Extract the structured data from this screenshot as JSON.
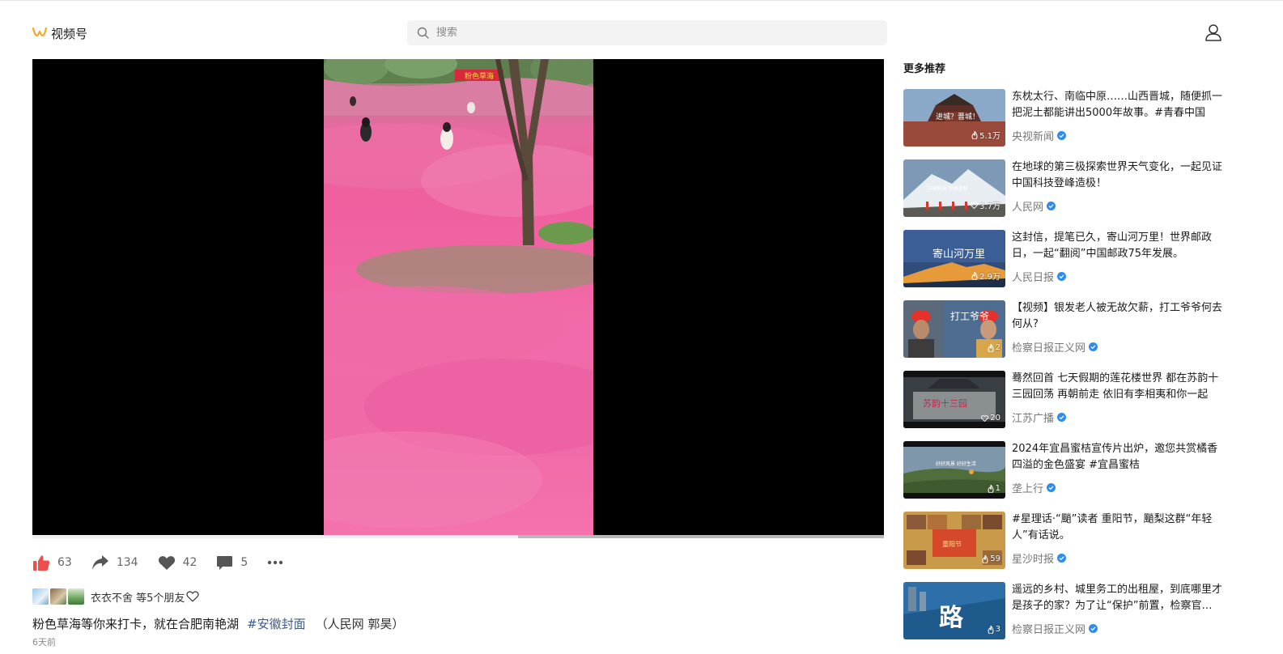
{
  "header": {
    "app_name": "视频号",
    "search_placeholder": "搜索"
  },
  "video": {
    "progress": 0.43,
    "banner_text": "粉色草海"
  },
  "actions": {
    "like_count": "63",
    "share_count": "134",
    "favorite_count": "42",
    "comment_count": "5"
  },
  "friends": {
    "text": "衣衣不舍 等5个朋友"
  },
  "post": {
    "caption": "粉色草海等你来打卡，就在合肥南艳湖",
    "hashtag": "#安徽封面",
    "source": "（人民网 郭昊）",
    "time": "6天前"
  },
  "sidebar": {
    "title": "更多推荐",
    "items": [
      {
        "title": "东枕太行、南临中原……山西晋城，随便抓一把泥土都能讲出5000年故事。#青春中国",
        "author": "央视新闻",
        "views": "5.1万",
        "thumb_text": "进城？晋城！"
      },
      {
        "title": "在地球的第三极探索世界天气变化，一起见证中国科技登峰造极！",
        "author": "人民网",
        "views": "3.7万",
        "thumb_text": "中国科技 登峰造极"
      },
      {
        "title": "这封信，提笔已久，寄山河万里！世界邮政日，一起“翻阅”中国邮政75年发展。",
        "author": "人民日报",
        "views": "2.9万",
        "thumb_text": "寄山河万里"
      },
      {
        "title": "【视频】银发老人被无故欠薪，打工爷爷何去何从?",
        "author": "检察日报正义网",
        "views": "2",
        "thumb_text": "打工爷爷"
      },
      {
        "title": "蓦然回首 七天假期的莲花楼世界 都在苏韵十三园回荡 再朝前走 依旧有李相夷和你一起",
        "author": "江苏广播",
        "views": "20",
        "thumb_text": "苏韵十三园"
      },
      {
        "title": "2024年宜昌蜜桔宣传片出炉，邀您共赏橘香四溢的金色盛宴 #宜昌蜜桔",
        "author": "垄上行",
        "views": "1",
        "thumb_text": "好好风景 好好生活"
      },
      {
        "title": "#星理话·“颵”读者 重阳节，颵梨这群“年轻人”有话说。",
        "author": "星沙时报",
        "views": "59",
        "thumb_text": "重阳节"
      },
      {
        "title": "遥远的乡村、城里务工的出租屋，到底哪里才是孩子的家？为了让“保护”前置，检察官们在行动",
        "author": "检察日报正义网",
        "views": "3",
        "thumb_text": "路"
      }
    ]
  }
}
